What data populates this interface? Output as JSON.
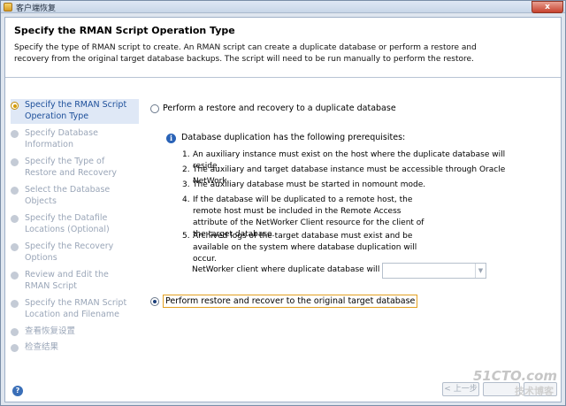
{
  "window": {
    "title": "客户端恢复",
    "close_label": "x"
  },
  "header": {
    "title": "Specify the RMAN Script Operation Type",
    "description": "Specify the type of RMAN script to create. An RMAN script can create a duplicate database or perform a restore and recovery from the original target database backups.  The script will need to be run manually to perform the restore."
  },
  "steps": [
    {
      "label": "Specify the RMAN Script Operation Type",
      "active": true
    },
    {
      "label": "Specify Database Information",
      "active": false
    },
    {
      "label": "Specify the Type of Restore and Recovery",
      "active": false
    },
    {
      "label": "Select the Database Objects",
      "active": false
    },
    {
      "label": "Specify the Datafile Locations (Optional)",
      "active": false
    },
    {
      "label": "Specify the Recovery Options",
      "active": false
    },
    {
      "label": "Review and Edit the RMAN Script",
      "active": false
    },
    {
      "label": "Specify the RMAN Script Location and Filename",
      "active": false
    },
    {
      "label": "查看恢复设置",
      "active": false
    },
    {
      "label": "检查结果",
      "active": false
    }
  ],
  "options": {
    "duplicate": {
      "label": "Perform a restore and recovery to a duplicate database",
      "checked": false
    },
    "original": {
      "label": "Perform restore and recover to the original target database",
      "checked": true
    }
  },
  "prereq": {
    "title": "Database duplication has the following prerequisites:",
    "items": [
      {
        "num": "1.",
        "text": "An auxiliary instance must exist on the host where the duplicate database will reside."
      },
      {
        "num": "2.",
        "text": "The auxiliary and target database instance must be accessible through Oracle NetWork."
      },
      {
        "num": "3.",
        "text": "The auxiliary database must be started in nomount mode."
      },
      {
        "num": "4.",
        "text": "If the database will be duplicated to a remote host, the remote host must be included in the Remote Access attribute of the NetWorker Client resource for the client of the target database."
      },
      {
        "num": "5.",
        "text": "Archived logs of the target database must exist and be available on the system where database duplication will occur."
      }
    ]
  },
  "networker": {
    "label": "NetWorker client where duplicate database will reside:",
    "value": ""
  },
  "buttons": {
    "back": "< 上一步"
  },
  "watermark": {
    "line1": "51CTO.com",
    "line2": "技术博客"
  },
  "icons": {
    "info": "info-icon",
    "help": "help-icon",
    "app": "app-icon"
  }
}
